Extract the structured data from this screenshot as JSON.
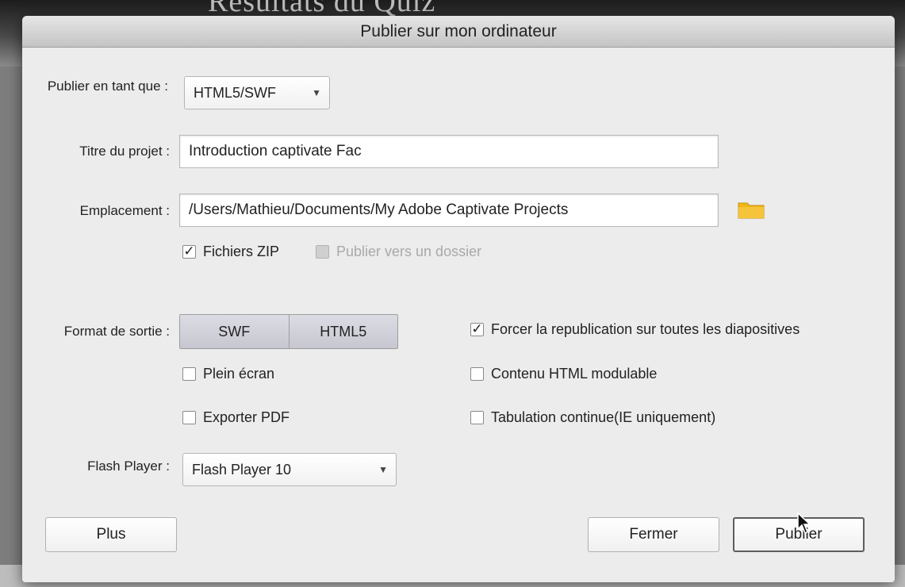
{
  "background": {
    "title_fragment": "Résultats du Quiz"
  },
  "dialog": {
    "title": "Publier sur mon ordinateur"
  },
  "publish_as": {
    "label": "Publier en tant que :",
    "value": "HTML5/SWF"
  },
  "project_title": {
    "label": "Titre du projet :",
    "value": "Introduction captivate Fac"
  },
  "location": {
    "label": "Emplacement :",
    "value": "/Users/Mathieu/Documents/My Adobe Captivate Projects",
    "browse_icon": "folder-icon"
  },
  "zip_files": {
    "label": "Fichiers ZIP",
    "checked": true
  },
  "publish_folder": {
    "label": "Publier vers un dossier",
    "checked": false,
    "disabled": true
  },
  "output_format": {
    "label": "Format de sortie :",
    "options": [
      "SWF",
      "HTML5"
    ]
  },
  "options_left": [
    {
      "label": "Plein écran",
      "checked": false
    },
    {
      "label": "Exporter PDF",
      "checked": false
    }
  ],
  "options_right": [
    {
      "label": "Forcer la republication sur toutes les diapositives",
      "checked": true
    },
    {
      "label": "Contenu HTML modulable",
      "checked": false
    },
    {
      "label": "Tabulation continue(IE uniquement)",
      "checked": false
    }
  ],
  "flash_player": {
    "label": "Flash Player :",
    "value": "Flash Player 10"
  },
  "buttons": {
    "more": "Plus",
    "close": "Fermer",
    "publish": "Publier"
  },
  "colors": {
    "folder": "#f0b71a",
    "segment": "#d3d3dc",
    "dialog_bg": "#ececec"
  }
}
